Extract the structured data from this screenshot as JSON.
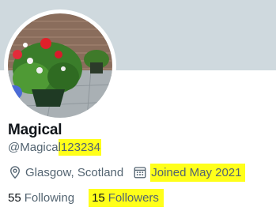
{
  "profile": {
    "display_name": "Magical",
    "handle_prefix": "@Magica",
    "handle_highlighted": "l123234",
    "location": "Glasgow, Scotland",
    "joined": "Joined May 2021",
    "following_count": "55",
    "following_label": "Following",
    "followers_count": "15",
    "followers_label": "Followers"
  },
  "icons": {
    "location": "location-pin-icon",
    "joined": "calendar-icon"
  },
  "colors": {
    "banner": "#cfd9de",
    "highlight": "#ffff1a",
    "secondary_text": "#536471",
    "primary_text": "#0f1419"
  }
}
